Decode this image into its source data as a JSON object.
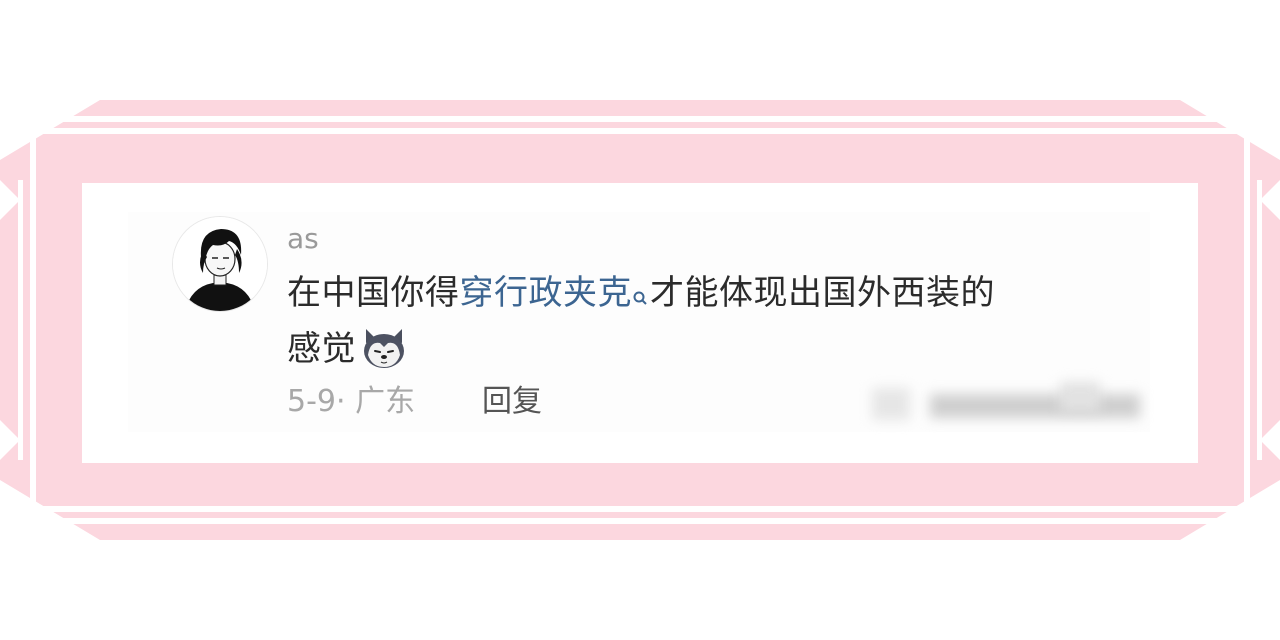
{
  "comment": {
    "username": "as",
    "text_before": "在中国你得",
    "link_text": "穿行政夹克",
    "text_after_line1": "才能体现出国外西装的",
    "text_line2": "感觉",
    "date_location": "5-9· 广东",
    "reply_label": "回复"
  },
  "icons": {
    "avatar": "avatar-illustration",
    "search": "search-icon",
    "emoji": "husky-dog-emoji",
    "redacted": "blurred-like-area"
  },
  "colors": {
    "frame": "#fcd7df",
    "link": "#3c6591",
    "text": "#2b2b2b",
    "meta": "#a8a8a8"
  }
}
